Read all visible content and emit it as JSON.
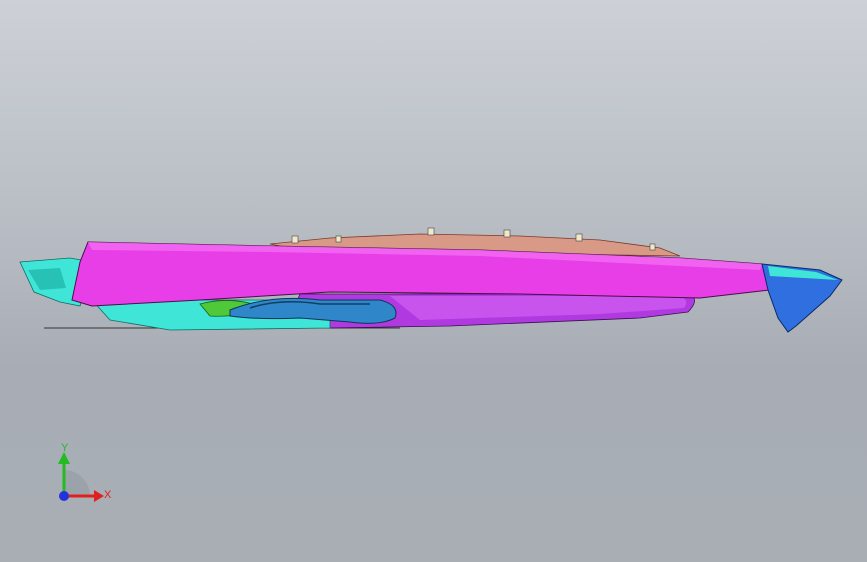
{
  "viewport": {
    "triad": {
      "x_label": "X",
      "y_label": "Y",
      "x_color": "#e02020",
      "y_color": "#22bb22",
      "z_color": "#2233dd"
    },
    "model": {
      "colors": {
        "deck": "#e83ee8",
        "hull_bottom": "#b03ae0",
        "cyan_parts": "#3fe6d8",
        "blue_cap": "#2f6fe0",
        "tan_top": "#d89a86",
        "tube": "#2f86c8",
        "green_part": "#4fc83a"
      }
    }
  }
}
